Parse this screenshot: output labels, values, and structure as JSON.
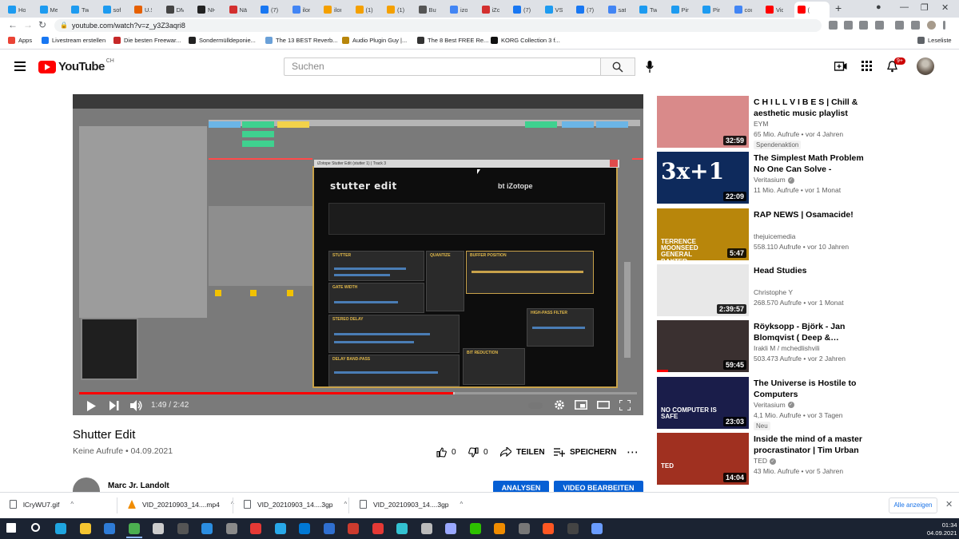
{
  "browser": {
    "tabs": [
      {
        "label": "Hom",
        "color": "#1d9bf0"
      },
      {
        "label": "Mec",
        "color": "#1d9bf0"
      },
      {
        "label": "Twe",
        "color": "#1d9bf0"
      },
      {
        "label": "sofo",
        "color": "#1d9bf0"
      },
      {
        "label": "U.S.",
        "color": "#e66000"
      },
      {
        "label": "DMA",
        "color": "#444444"
      },
      {
        "label": "NHT",
        "color": "#222222"
      },
      {
        "label": "Näc",
        "color": "#d32f2f"
      },
      {
        "label": "(7) M",
        "color": "#1877f2"
      },
      {
        "label": "ilons",
        "color": "#4285f4"
      },
      {
        "label": "ilons",
        "color": "#f4a000"
      },
      {
        "label": "(1) S",
        "color": "#f4a000"
      },
      {
        "label": "(1) S",
        "color": "#f4a000"
      },
      {
        "label": "Buy",
        "color": "#555555"
      },
      {
        "label": "izot",
        "color": "#4285f4"
      },
      {
        "label": "iZot",
        "color": "#d32f2f"
      },
      {
        "label": "(7) i",
        "color": "#1877f2"
      },
      {
        "label": "VST",
        "color": "#1d9bf0"
      },
      {
        "label": "(7) A",
        "color": "#1877f2"
      },
      {
        "label": "sata",
        "color": "#4285f4"
      },
      {
        "label": "Twe",
        "color": "#1d9bf0"
      },
      {
        "label": "Pink",
        "color": "#1d9bf0"
      },
      {
        "label": "Pink",
        "color": "#1d9bf0"
      },
      {
        "label": "cou",
        "color": "#4285f4"
      },
      {
        "label": "Vide",
        "color": "#ff0000"
      },
      {
        "label": "(",
        "color": "#ff0000"
      }
    ],
    "new_tab": "+",
    "url": "youtube.com/watch?v=z_y3Z3aqri8",
    "bookmarks": [
      {
        "label": "Apps",
        "color": "#ea4335"
      },
      {
        "label": "Livestream erstellen",
        "color": "#1877f2"
      },
      {
        "label": "Die besten Freewar...",
        "color": "#c62828"
      },
      {
        "label": "Sondermülldeponie...",
        "color": "#222222"
      },
      {
        "label": "The 13 BEST Reverb...",
        "color": "#6aa0d8"
      },
      {
        "label": "Audio Plugin Guy |...",
        "color": "#b8860b"
      },
      {
        "label": "The 8 Best FREE Re...",
        "color": "#333333"
      },
      {
        "label": "KORG Collection 3 f...",
        "color": "#111111"
      }
    ],
    "reading_list": "Leseliste"
  },
  "youtube": {
    "logo_text": "YouTube",
    "country": "CH",
    "search_placeholder": "Suchen",
    "notifications": "9+"
  },
  "player": {
    "plugin_title": "iZotope Stutter Edit (stutter 1) | Track 3",
    "plugin_name": "stutter edit",
    "plugin_brand": "bt  iZotope",
    "modules": [
      "STUTTER",
      "QUANTIZE",
      "BUFFER POSITION",
      "GATE WIDTH",
      "STEREO DELAY",
      "HIGH-PASS FILTER",
      "DELAY BAND-PASS",
      "BIT REDUCTION"
    ],
    "time": "1:49 / 2:42",
    "progress": 0.67,
    "buffered": 0.673
  },
  "video": {
    "title": "Shutter Edit",
    "meta": "Keine Aufrufe • 04.09.2021",
    "likes": "0",
    "dislikes": "0",
    "share": "TEILEN",
    "save": "SPEICHERN",
    "channel": "Marc Jr. Landolt",
    "analytics_btn": "ANALYSEN",
    "edit_btn": "VIDEO BEARBEITEN"
  },
  "recommendations": [
    {
      "title": "C H I L L V I B E S | Chill & aesthetic music playlist",
      "channel": "EYM",
      "verified": false,
      "views": "65 Mio. Aufrufe • vor 4 Jahren",
      "duration": "32:59",
      "badge": "Spendenaktion",
      "thumb": "#d98a8a"
    },
    {
      "title": "The Simplest Math Problem No One Can Solve - Collatz…",
      "channel": "Veritasium",
      "verified": true,
      "views": "11 Mio. Aufrufe • vor 1 Monat",
      "duration": "22:09",
      "badge": "",
      "thumb": "#0e2a5c",
      "thumb_text": "3x+1"
    },
    {
      "title": "RAP NEWS | Osamacide!",
      "channel": "thejuicemedia",
      "verified": false,
      "views": "558.110 Aufrufe • vor 10 Jahren",
      "duration": "5:47",
      "badge": "",
      "thumb": "#b8860b",
      "thumb_text": "TERRENCE MOONSEED   GENERAL BAXTER"
    },
    {
      "title": "Head Studies",
      "channel": "Christophe Y",
      "verified": false,
      "views": "268.570 Aufrufe • vor 1 Monat",
      "duration": "2:39:57",
      "badge": "",
      "thumb": "#e8e8e8"
    },
    {
      "title": "Röyksopp - Björk - Jan Blomqvist ( Deep &…",
      "channel": "Irakli M / mchedlishvili",
      "verified": false,
      "views": "503.473 Aufrufe • vor 2 Jahren",
      "duration": "59:45",
      "badge": "",
      "thumb": "#3a3030",
      "watched": 0.12
    },
    {
      "title": "The Universe is Hostile to Computers",
      "channel": "Veritasium",
      "verified": true,
      "views": "4,1 Mio. Aufrufe • vor 3 Tagen",
      "duration": "23:03",
      "badge": "Neu",
      "thumb": "#1a1d4a",
      "thumb_text": "NO COMPUTER IS SAFE"
    },
    {
      "title": "Inside the mind of a master procrastinator | Tim Urban",
      "channel": "TED",
      "verified": true,
      "views": "43 Mio. Aufrufe • vor 5 Jahren",
      "duration": "14:04",
      "badge": "",
      "thumb": "#a03020",
      "thumb_text": "TED"
    }
  ],
  "downloads": {
    "items": [
      {
        "name": "lCryWU7.gif",
        "type": "file"
      },
      {
        "name": "VID_20210903_14....mp4",
        "type": "vlc"
      },
      {
        "name": "VID_20210903_14....3gp",
        "type": "file"
      },
      {
        "name": "VID_20210903_14....3gp",
        "type": "file"
      }
    ],
    "show_all": "Alle anzeigen"
  },
  "taskbar": {
    "apps": [
      {
        "name": "windows",
        "color": "#ffffff"
      },
      {
        "name": "search",
        "color": "#ffffff"
      },
      {
        "name": "edge",
        "color": "#1fa5e0"
      },
      {
        "name": "file-explorer",
        "color": "#f4c430"
      },
      {
        "name": "mail",
        "color": "#2e7bd6"
      },
      {
        "name": "chrome",
        "color": "#4caf50"
      },
      {
        "name": "inkscape",
        "color": "#cccccc"
      },
      {
        "name": "live",
        "color": "#555555"
      },
      {
        "name": "vscode",
        "color": "#2b8de0"
      },
      {
        "name": "settings",
        "color": "#8a8a8a"
      },
      {
        "name": "screenshot",
        "color": "#e53935"
      },
      {
        "name": "telegram",
        "color": "#28a8e9"
      },
      {
        "name": "skype",
        "color": "#0078d4"
      },
      {
        "name": "photos",
        "color": "#2f6fd0"
      },
      {
        "name": "xnview",
        "color": "#cc3b2e"
      },
      {
        "name": "notepad",
        "color": "#e53935"
      },
      {
        "name": "clipchamp",
        "color": "#33c2d2"
      },
      {
        "name": "box",
        "color": "#bbbbbb"
      },
      {
        "name": "3d-viewer",
        "color": "#9aa8ff"
      },
      {
        "name": "wechat",
        "color": "#2dc100"
      },
      {
        "name": "vlc",
        "color": "#f08c00"
      },
      {
        "name": "files",
        "color": "#777777"
      },
      {
        "name": "circle-app",
        "color": "#ff5722"
      },
      {
        "name": "obs",
        "color": "#444444"
      },
      {
        "name": "arrow-app",
        "color": "#6a9cff"
      }
    ],
    "time": "01:34",
    "date": "04.09.2021"
  }
}
